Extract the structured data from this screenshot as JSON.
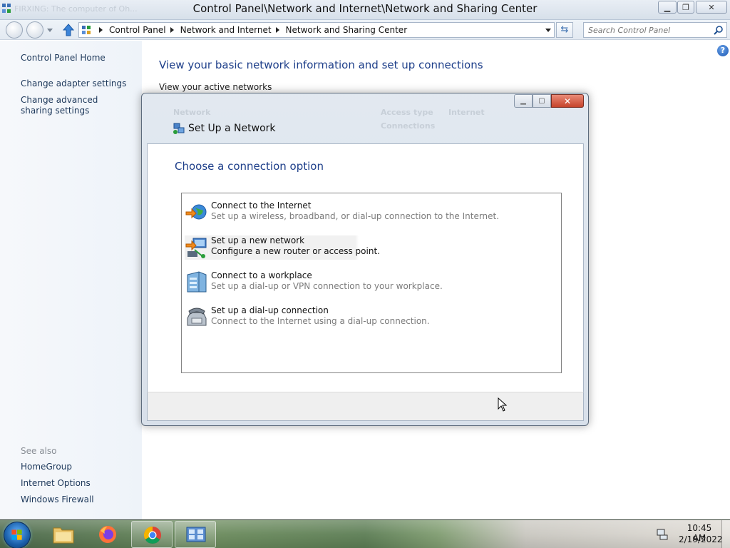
{
  "window": {
    "title": "Control Panel\\Network and Internet\\Network and Sharing Center",
    "ghost_tab": "FIRXING: The computer of Oh..."
  },
  "address_bar": {
    "crumbs": [
      "Control Panel",
      "Network and Internet",
      "Network and Sharing Center"
    ],
    "search_placeholder": "Search Control Panel"
  },
  "left_pane": {
    "links": [
      "Control Panel Home",
      "Change adapter settings",
      "Change advanced sharing settings"
    ],
    "see_also_label": "See also",
    "see_also": [
      "HomeGroup",
      "Internet Options",
      "Windows Firewall"
    ]
  },
  "main": {
    "heading": "View your basic network information and set up connections",
    "active_networks": "View your active networks",
    "help_icon": "?"
  },
  "dialog": {
    "title": "Set Up a Network",
    "heading": "Choose a connection option",
    "options": [
      {
        "title": "Connect to the Internet",
        "description": "Set up a wireless, broadband, or dial-up connection to the Internet.",
        "icon": "globe-icon"
      },
      {
        "title": "Set up a new network",
        "description": "Configure a new router or access point.",
        "icon": "network-computers-icon",
        "selected": true
      },
      {
        "title": "Connect to a workplace",
        "description": "Set up a dial-up or VPN connection to your workplace.",
        "icon": "workplace-building-icon"
      },
      {
        "title": "Set up a dial-up connection",
        "description": "Connect to the Internet using a dial-up connection.",
        "icon": "telephone-icon"
      }
    ],
    "ghost_text": {
      "network": "Network",
      "access_type": "Access type",
      "internet": "Internet",
      "connections": "Connections"
    }
  },
  "taskbar": {
    "items": [
      "windows-explorer",
      "firefox",
      "chrome",
      "control-panel"
    ],
    "time": "10:45 AM",
    "date": "2/19/2022"
  }
}
